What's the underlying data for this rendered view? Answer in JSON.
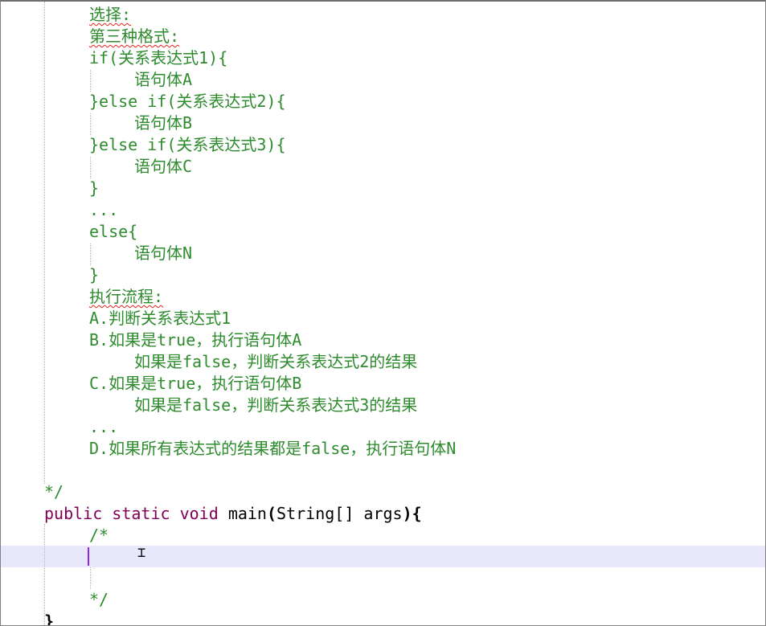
{
  "editor": {
    "lines": {
      "l1": "选择:",
      "l2": "第三种格式:",
      "l3": "if(关系表达式1){",
      "l4": "语句体A",
      "l5": "}else if(关系表达式2){",
      "l6": "语句体B",
      "l7": "}else if(关系表达式3){",
      "l8": "语句体C",
      "l9": "}",
      "l10": "...",
      "l11": "else{",
      "l12": "语句体N",
      "l13": "}",
      "l14": "执行流程:",
      "l15": "A.判断关系表达式1",
      "l16": "B.如果是true，执行语句体A",
      "l17": "如果是false，判断关系表达式2的结果",
      "l18": "C.如果是true，执行语句体B",
      "l19": "如果是false，判断关系表达式3的结果",
      "l20": "...",
      "l21": "D.如果所有表达式的结果都是false，执行语句体N",
      "l22": "*/",
      "main": {
        "kw_public": "public",
        "kw_static": "static",
        "kw_void": "void",
        "name": "main",
        "paren_open": "(",
        "type": "String[]",
        "arg": "args",
        "paren_close": ")",
        "brace": "{"
      },
      "l24": "/*",
      "l27": "*/",
      "l28": "}"
    },
    "cursor_icon": "i-beam-cursor-icon",
    "colors": {
      "comment": "#2e8b2e",
      "keyword": "#7f0055",
      "current_line": "#e8e8fa",
      "caret": "#8a2be2",
      "spell_error": "#e0241b"
    }
  }
}
